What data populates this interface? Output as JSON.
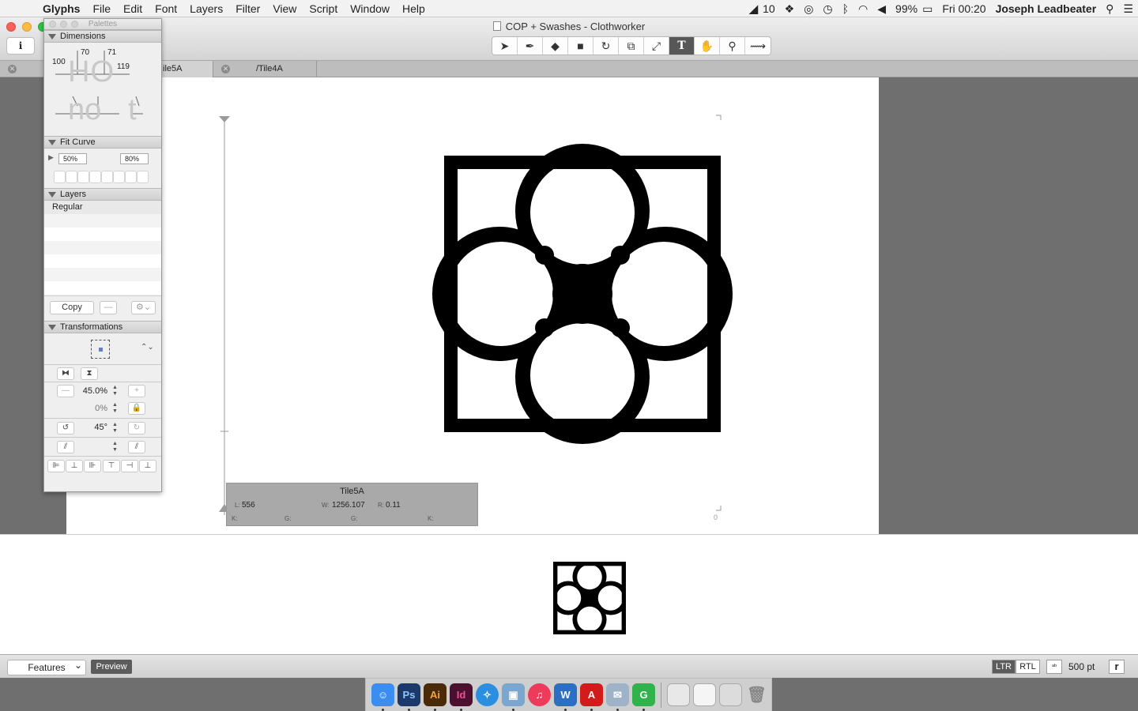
{
  "menubar": {
    "app_name": "Glyphs",
    "items": [
      "File",
      "Edit",
      "Font",
      "Layers",
      "Filter",
      "View",
      "Script",
      "Window",
      "Help"
    ],
    "adobe_count": "10",
    "battery": "99%",
    "clock": "Fri 00:20",
    "user": "Joseph Leadbeater"
  },
  "window": {
    "title": "COP + Swashes - Clothworker",
    "tabs": [
      "ile5A",
      "/Tile4A"
    ]
  },
  "toolbar": {
    "tools": [
      "select-tool-icon",
      "draw-tool-icon",
      "eraser-tool-icon",
      "rectangle-tool-icon",
      "rotate-tool-icon",
      "scale-tool-icon",
      "knife-tool-icon",
      "text-tool-icon",
      "hand-tool-icon",
      "zoom-tool-icon",
      "measure-tool-icon"
    ],
    "active_tool": "text-tool-icon"
  },
  "palettes": {
    "title": "Palettes",
    "dimensions": {
      "heading": "Dimensions",
      "cap_height": "100",
      "stem_h": "70",
      "stem_o": "71",
      "overshoot": "119",
      "sample_upper": "HO",
      "sample_lower": "no",
      "sample_t": "t"
    },
    "fit_curve": {
      "heading": "Fit Curve",
      "min": "50%",
      "max": "80%"
    },
    "layers": {
      "heading": "Layers",
      "items": [
        "Regular"
      ],
      "copy_label": "Copy"
    },
    "transformations": {
      "heading": "Transformations",
      "scale": "45.0%",
      "scale2": "0%",
      "rotate": "45°"
    }
  },
  "glyph_info": {
    "name": "Tile5A",
    "lsb_label": "L:",
    "lsb": "556",
    "width_label": "W:",
    "width": "1256.107",
    "rsb_label": "R:",
    "rsb": "0.11",
    "k_left": "K:",
    "g_left": "G:",
    "g_right": "G:",
    "k_right": "K:"
  },
  "canvas": {
    "corner_value": "0"
  },
  "bottombar": {
    "features": "Features",
    "preview": "Preview",
    "ltr": "LTR",
    "rtl": "RTL",
    "size": "500 pt"
  },
  "dock": {
    "apps": [
      {
        "name": "finder-icon",
        "label": "",
        "color": "#3b8ef0"
      },
      {
        "name": "photoshop-icon",
        "label": "Ps",
        "color": "#1b3a6b"
      },
      {
        "name": "illustrator-icon",
        "label": "Ai",
        "color": "#4a2a08"
      },
      {
        "name": "indesign-icon",
        "label": "Id",
        "color": "#4b0f2f"
      },
      {
        "name": "safari-icon",
        "label": "",
        "color": "#2a8fe0"
      },
      {
        "name": "preview-icon",
        "label": "",
        "color": "#7aa7cf"
      },
      {
        "name": "itunes-icon",
        "label": "♫",
        "color": "#ee3b5b"
      },
      {
        "name": "word-icon",
        "label": "W",
        "color": "#2b6fc5"
      },
      {
        "name": "acrobat-icon",
        "label": "A",
        "color": "#d21c1c"
      },
      {
        "name": "mail-icon",
        "label": "",
        "color": "#9fb3c8"
      },
      {
        "name": "glyphs-icon",
        "label": "G",
        "color": "#2fb34a"
      }
    ]
  }
}
